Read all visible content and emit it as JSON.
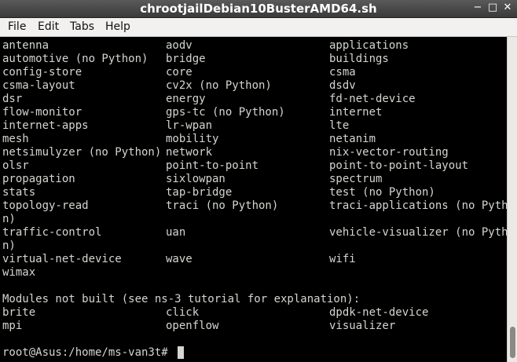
{
  "window": {
    "title": "chrootjailDebian10BusterAMD64.sh",
    "minimize_glyph": "−",
    "maximize_glyph": "□",
    "close_glyph": "✕"
  },
  "menubar": {
    "items": [
      "File",
      "Edit",
      "Tabs",
      "Help"
    ]
  },
  "terminal": {
    "lines": [
      [
        "antenna",
        "aodv",
        "applications"
      ],
      [
        "automotive (no Python)",
        "bridge",
        "buildings"
      ],
      [
        "config-store",
        "core",
        "csma"
      ],
      [
        "csma-layout",
        "cv2x (no Python)",
        "dsdv"
      ],
      [
        "dsr",
        "energy",
        "fd-net-device"
      ],
      [
        "flow-monitor",
        "gps-tc (no Python)",
        "internet"
      ],
      [
        "internet-apps",
        "lr-wpan",
        "lte"
      ],
      [
        "mesh",
        "mobility",
        "netanim"
      ],
      [
        "netsimulyzer (no Python)",
        "network",
        "nix-vector-routing"
      ],
      [
        "olsr",
        "point-to-point",
        "point-to-point-layout"
      ],
      [
        "propagation",
        "sixlowpan",
        "spectrum"
      ],
      [
        "stats",
        "tap-bridge",
        "test (no Python)"
      ],
      [
        "topology-read",
        "traci (no Python)",
        "traci-applications (no Pytho"
      ],
      [
        "n)",
        "",
        ""
      ],
      [
        "traffic-control",
        "uan",
        "vehicle-visualizer (no Pytho"
      ],
      [
        "n)",
        "",
        ""
      ],
      [
        "virtual-net-device",
        "wave",
        "wifi"
      ],
      [
        "wimax",
        "",
        ""
      ],
      [
        "",
        "",
        ""
      ],
      [
        "Modules not built (see ns-3 tutorial for explanation):",
        "",
        ""
      ],
      [
        "brite",
        "click",
        "dpdk-net-device"
      ],
      [
        "mpi",
        "openflow",
        "visualizer"
      ],
      [
        "",
        "",
        ""
      ]
    ],
    "prompt": "root@Asus:/home/ms-van3t# "
  },
  "colors": {
    "terminal_bg": "#000000",
    "terminal_fg": "#d3d7cf",
    "titlebar_bg": "#4a4a4a",
    "menubar_bg": "#f2f1f0"
  }
}
